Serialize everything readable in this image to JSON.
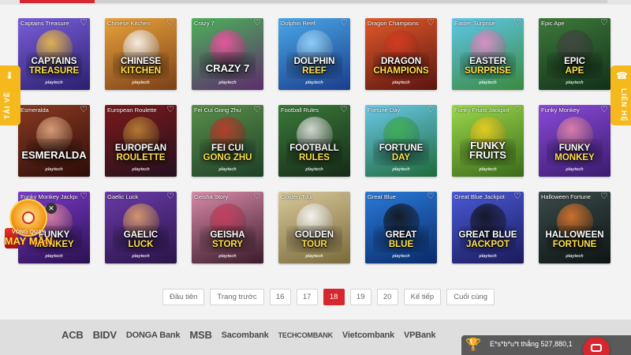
{
  "games": [
    {
      "name": "Captains Treasure",
      "title1": "CAPTAINS",
      "title2": "TREASURE",
      "bg": [
        "#7a5ed9",
        "#2b1f6e"
      ],
      "accent": "#f5c542"
    },
    {
      "name": "Chinese Kitchen",
      "title1": "CHINESE",
      "title2": "KITCHEN",
      "bg": [
        "#e8a23a",
        "#7b3f18"
      ],
      "accent": "#ffffff"
    },
    {
      "name": "Crazy 7",
      "title1": "CRAZY 7",
      "title2": "",
      "bg": [
        "#4cb05a",
        "#5e2b6e"
      ],
      "accent": "#ff4fa8"
    },
    {
      "name": "Dolphin Reef",
      "title1": "DOLPHIN",
      "title2": "REEF",
      "bg": [
        "#4aa7e8",
        "#1a3d8c"
      ],
      "accent": "#9fd8ff"
    },
    {
      "name": "Dragon Champions",
      "title1": "DRAGON",
      "title2": "CHAMPIONS",
      "bg": [
        "#e05a2a",
        "#5a1410"
      ],
      "accent": "#d83a22"
    },
    {
      "name": "Easter Surprise",
      "title1": "EASTER",
      "title2": "SURPRISE",
      "bg": [
        "#5fc6e8",
        "#3a8a3e"
      ],
      "accent": "#f08ac8"
    },
    {
      "name": "Epic Ape",
      "title1": "EPIC",
      "title2": "APE",
      "bg": [
        "#3d7a3a",
        "#12301a"
      ],
      "accent": "#444444"
    },
    {
      "name": "Esmeralda",
      "title1": "ESMERALDA",
      "title2": "",
      "bg": [
        "#8a3a22",
        "#2c0c08"
      ],
      "accent": "#e8b088"
    },
    {
      "name": "European Roulette",
      "title1": "EUROPEAN",
      "title2": "ROULETTE",
      "bg": [
        "#7a1a1a",
        "#24101e"
      ],
      "accent": "#c28a3a"
    },
    {
      "name": "Fei Cui Gong Zhu",
      "title1": "FEI CUI",
      "title2": "GONG ZHU",
      "bg": [
        "#5a8f4a",
        "#1e3f28"
      ],
      "accent": "#c8362a"
    },
    {
      "name": "Football Rules",
      "title1": "FOOTBALL",
      "title2": "RULES",
      "bg": [
        "#3a7a3a",
        "#162a18"
      ],
      "accent": "#eeeeee"
    },
    {
      "name": "Fortune Day",
      "title1": "FORTUNE",
      "title2": "DAY",
      "bg": [
        "#6ac8e8",
        "#1e6a3a"
      ],
      "accent": "#3eb04a"
    },
    {
      "name": "Funky Fruits Jackpot",
      "title1": "FUNKY FRUITS",
      "title2": "",
      "bg": [
        "#9ad84a",
        "#3a6a1a"
      ],
      "accent": "#f5d020"
    },
    {
      "name": "Funky Monkey",
      "title1": "FUNKY",
      "title2": "MONKEY",
      "bg": [
        "#8a4ad8",
        "#3a1a6e"
      ],
      "accent": "#e88aa8"
    },
    {
      "name": "Funky Monkey Jackpot",
      "title1": "FUNKY",
      "title2": "MONKEY",
      "bg": [
        "#7a3ac8",
        "#2a1050"
      ],
      "accent": "#e88aa8"
    },
    {
      "name": "Gaelic Luck",
      "title1": "GAELIC",
      "title2": "LUCK",
      "bg": [
        "#6a3aa8",
        "#2a1448"
      ],
      "accent": "#e8a86a"
    },
    {
      "name": "Geisha Story",
      "title1": "GEISHA",
      "title2": "STORY",
      "bg": [
        "#d88aa8",
        "#3a1a2a"
      ],
      "accent": "#c83a5a"
    },
    {
      "name": "Golden Tour",
      "title1": "GOLDEN",
      "title2": "TOUR",
      "bg": [
        "#d8c89a",
        "#7a6a3a"
      ],
      "accent": "#ffffff"
    },
    {
      "name": "Great Blue",
      "title1": "GREAT",
      "title2": "BLUE",
      "bg": [
        "#2a7ad8",
        "#0a2a6a"
      ],
      "accent": "#111111"
    },
    {
      "name": "Great Blue Jackpot",
      "title1": "GREAT BLUE",
      "title2": "JACKPOT",
      "bg": [
        "#4a5ad8",
        "#1a1a5a"
      ],
      "accent": "#111111"
    },
    {
      "name": "Halloween Fortune",
      "title1": "HALLOWEEN",
      "title2": "FORTUNE",
      "bg": [
        "#3a4a4a",
        "#0e1414"
      ],
      "accent": "#e87a2a"
    }
  ],
  "brand_label": "playtech",
  "side_left": {
    "label": "TẢI VỀ",
    "icon": "download-icon"
  },
  "side_right": {
    "label": "LIÊN HỆ",
    "icon": "phone-icon"
  },
  "promo": {
    "line1": "VÒNG QUAY",
    "line2": "MAY MẮN",
    "close": "✕"
  },
  "pagination": {
    "first": "Đầu tiên",
    "prev": "Trang trước",
    "pages": [
      "16",
      "17",
      "18",
      "19",
      "20"
    ],
    "active": "18",
    "next": "Kế tiếp",
    "last": "Cuối cùng"
  },
  "banks": [
    "ACB",
    "BIDV",
    "DONGA Bank",
    "MSB",
    "Sacombank",
    "TECHCOMBANK",
    "Vietcombank",
    "VPBank"
  ],
  "ticker": {
    "text": "E*s*b*u*t thắng 527,880,1"
  },
  "colors": {
    "accent": "#d6262e",
    "side_tab": "#f5b91d",
    "footer": "#dedede"
  }
}
